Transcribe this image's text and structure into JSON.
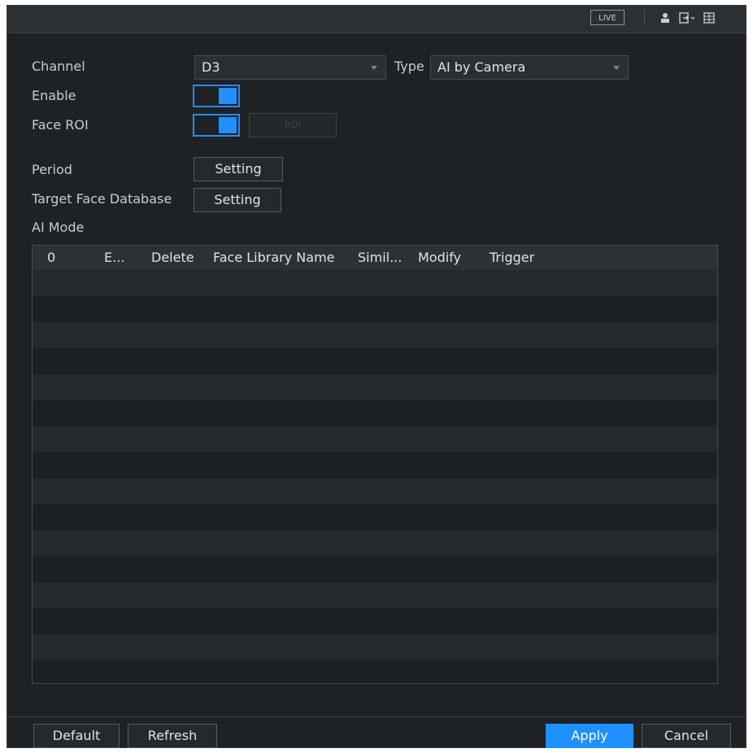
{
  "topbar": {
    "live_label": "LIVE",
    "icons": [
      "user-icon",
      "logout-icon",
      "menu-grid-icon"
    ]
  },
  "form": {
    "channel_label": "Channel",
    "channel_value": "D3",
    "type_label": "Type",
    "type_value": "AI by Camera",
    "enable_label": "Enable",
    "enable_on": true,
    "face_roi_label": "Face ROI",
    "face_roi_on": true,
    "roi_button_label": "ROI",
    "period_label": "Period",
    "period_button": "Setting",
    "target_db_label": "Target Face Database",
    "target_db_button": "Setting",
    "ai_mode_label": "AI Mode"
  },
  "table": {
    "columns": [
      "0",
      "E...",
      "Delete",
      "Face Library Name",
      "Simil...",
      "Modify",
      "Trigger"
    ],
    "rows": []
  },
  "footer": {
    "default_label": "Default",
    "refresh_label": "Refresh",
    "apply_label": "Apply",
    "cancel_label": "Cancel"
  },
  "colors": {
    "accent": "#1e90ff",
    "background": "#1e2226"
  }
}
